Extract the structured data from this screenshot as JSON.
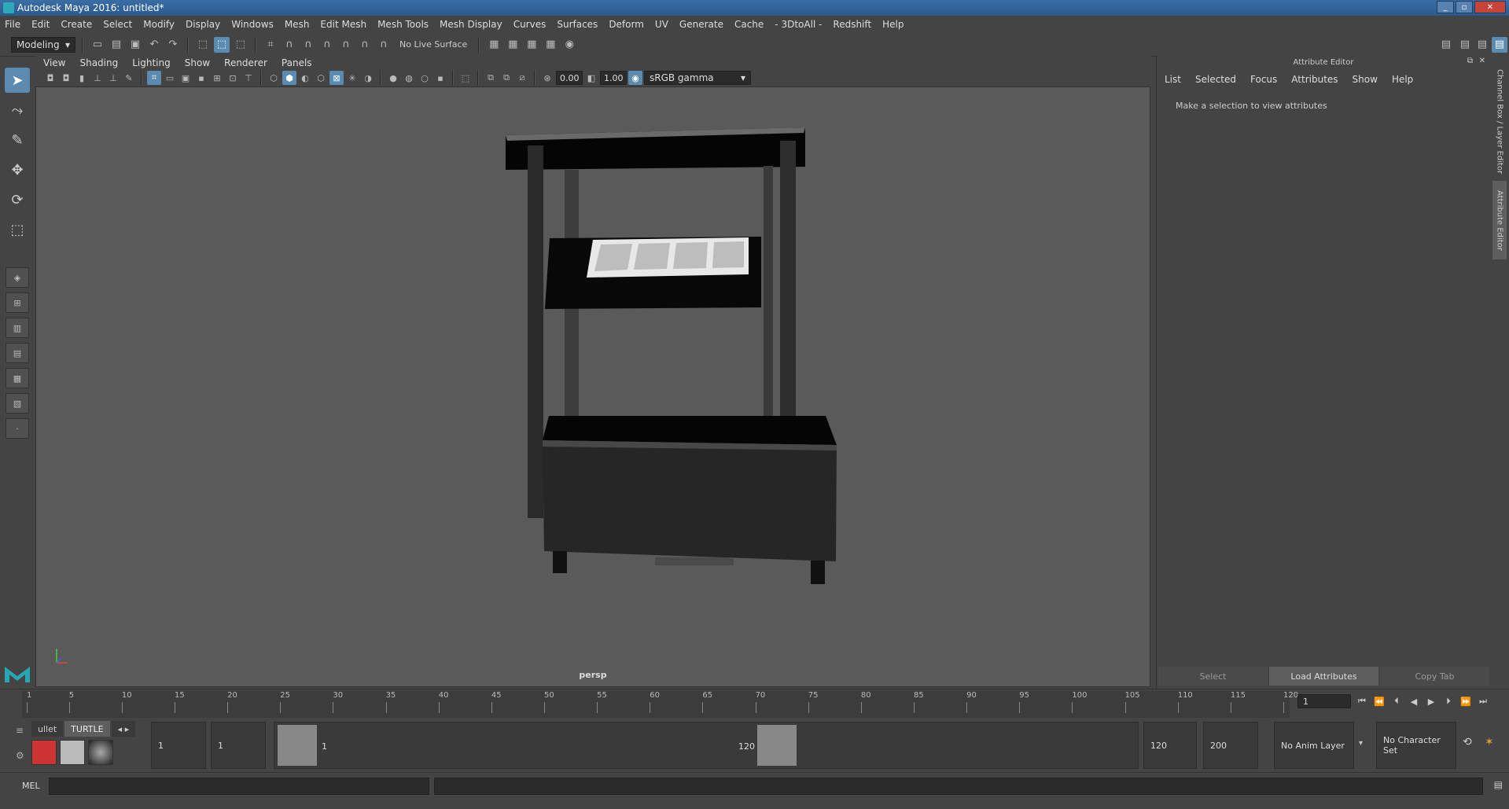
{
  "window": {
    "title": "Autodesk Maya 2016: untitled*"
  },
  "menubar": [
    "File",
    "Edit",
    "Create",
    "Select",
    "Modify",
    "Display",
    "Windows",
    "Mesh",
    "Edit Mesh",
    "Mesh Tools",
    "Mesh Display",
    "Curves",
    "Surfaces",
    "Deform",
    "UV",
    "Generate",
    "Cache",
    "- 3DtoAll -",
    "Redshift",
    "Help"
  ],
  "statusline": {
    "mode": "Modeling",
    "live_surface": "No Live Surface"
  },
  "panel": {
    "menu": [
      "View",
      "Shading",
      "Lighting",
      "Show",
      "Renderer",
      "Panels"
    ],
    "exposure": "0.00",
    "gamma": "1.00",
    "color_space": "sRGB gamma",
    "camera_label": "persp"
  },
  "attribute_editor": {
    "title": "Attribute Editor",
    "menu": [
      "List",
      "Selected",
      "Focus",
      "Attributes",
      "Show",
      "Help"
    ],
    "message": "Make a selection to view attributes",
    "buttons": {
      "select": "Select",
      "load": "Load Attributes",
      "copy": "Copy Tab"
    }
  },
  "side_tabs": {
    "channel_box": "Channel Box / Layer Editor",
    "attribute_editor": "Attribute Editor"
  },
  "timeline": {
    "ticks": [
      "1",
      "5",
      "10",
      "15",
      "20",
      "25",
      "30",
      "35",
      "40",
      "45",
      "50",
      "55",
      "60",
      "65",
      "70",
      "75",
      "80",
      "85",
      "90",
      "95",
      "100",
      "105",
      "110",
      "115",
      "120"
    ],
    "current_frame": "1"
  },
  "range": {
    "shelf_tabs": [
      "ullet",
      "TURTLE"
    ],
    "start_outer": "1",
    "start_inner": "1",
    "slider_start": "1",
    "slider_end": "120",
    "end_inner": "120",
    "end_outer": "200",
    "anim_layer": "No Anim Layer",
    "character_set": "No Character Set"
  },
  "cmdline": {
    "label": "MEL"
  },
  "colors": {
    "accent": "#5b8bb0",
    "titlebar": "#2b5a8e",
    "viewport": "#5a5a5a"
  }
}
